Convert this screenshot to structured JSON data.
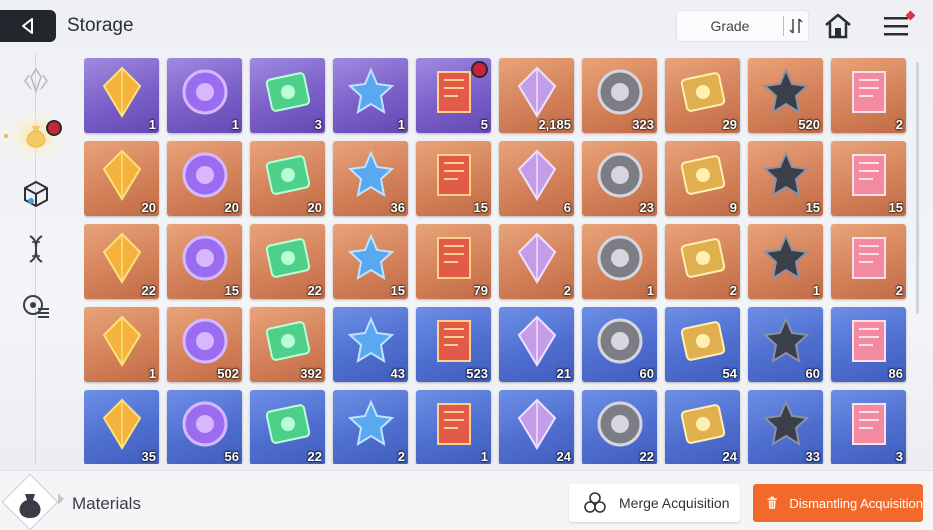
{
  "header": {
    "title": "Storage",
    "sort_label": "Grade"
  },
  "sidebar": {
    "items": [
      {
        "name": "crystal-tab",
        "active": false
      },
      {
        "name": "materials-tab",
        "active": true,
        "badge": true
      },
      {
        "name": "cube-tab",
        "active": false
      },
      {
        "name": "dna-tab",
        "active": false
      },
      {
        "name": "gear-list-tab",
        "active": false
      }
    ]
  },
  "items": [
    {
      "name": "tarot-cards",
      "count": "1",
      "rarity": "purple",
      "badge": false
    },
    {
      "name": "dark-orb",
      "count": "1",
      "rarity": "purple",
      "badge": false
    },
    {
      "name": "stone-idol-head",
      "count": "3",
      "rarity": "purple",
      "badge": false
    },
    {
      "name": "red-stone-head",
      "count": "1",
      "rarity": "purple",
      "badge": false
    },
    {
      "name": "pyramid-relic",
      "count": "5",
      "rarity": "purple",
      "badge": true
    },
    {
      "name": "blue-eye-creature",
      "count": "2,185",
      "rarity": "orange",
      "badge": false
    },
    {
      "name": "dark-chip",
      "count": "323",
      "rarity": "orange",
      "badge": false
    },
    {
      "name": "gold-id-card",
      "count": "29",
      "rarity": "orange",
      "badge": false
    },
    {
      "name": "gold-ticket",
      "count": "520",
      "rarity": "orange",
      "badge": false
    },
    {
      "name": "moon-feather",
      "count": "2",
      "rarity": "orange",
      "badge": false
    },
    {
      "name": "orange-crystal",
      "count": "20",
      "rarity": "orange",
      "badge": false
    },
    {
      "name": "purple-crystal",
      "count": "20",
      "rarity": "orange",
      "badge": false
    },
    {
      "name": "green-crystal",
      "count": "20",
      "rarity": "orange",
      "badge": false
    },
    {
      "name": "blue-crystal",
      "count": "36",
      "rarity": "orange",
      "badge": false
    },
    {
      "name": "eye-book",
      "count": "15",
      "rarity": "orange",
      "badge": false
    },
    {
      "name": "cross-book",
      "count": "6",
      "rarity": "orange",
      "badge": false
    },
    {
      "name": "bolt-book",
      "count": "23",
      "rarity": "orange",
      "badge": false
    },
    {
      "name": "atom-book",
      "count": "9",
      "rarity": "orange",
      "badge": false
    },
    {
      "name": "sword-medal",
      "count": "15",
      "rarity": "orange",
      "badge": false
    },
    {
      "name": "shield-medal",
      "count": "15",
      "rarity": "orange",
      "badge": false
    },
    {
      "name": "eye-medal",
      "count": "22",
      "rarity": "orange",
      "badge": false
    },
    {
      "name": "cross-medal",
      "count": "15",
      "rarity": "orange",
      "badge": false
    },
    {
      "name": "compass-medal",
      "count": "22",
      "rarity": "orange",
      "badge": false
    },
    {
      "name": "atom-medal",
      "count": "15",
      "rarity": "orange",
      "badge": false
    },
    {
      "name": "green-sprout",
      "count": "79",
      "rarity": "orange",
      "badge": false
    },
    {
      "name": "dark-gem-cube",
      "count": "2",
      "rarity": "orange",
      "badge": false
    },
    {
      "name": "sneakers",
      "count": "1",
      "rarity": "orange",
      "badge": false
    },
    {
      "name": "spray-bottle",
      "count": "2",
      "rarity": "orange",
      "badge": false
    },
    {
      "name": "dreamcatcher",
      "count": "1",
      "rarity": "orange",
      "badge": false
    },
    {
      "name": "old-book",
      "count": "2",
      "rarity": "orange",
      "badge": false
    },
    {
      "name": "pink-pick",
      "count": "1",
      "rarity": "orange",
      "badge": false
    },
    {
      "name": "music-scroll",
      "count": "502",
      "rarity": "orange",
      "badge": false
    },
    {
      "name": "black-flower",
      "count": "392",
      "rarity": "orange",
      "badge": false
    },
    {
      "name": "blue-id-card",
      "count": "43",
      "rarity": "blue",
      "badge": false
    },
    {
      "name": "blue-ticket",
      "count": "523",
      "rarity": "blue",
      "badge": false
    },
    {
      "name": "red-shard",
      "count": "21",
      "rarity": "blue",
      "badge": false
    },
    {
      "name": "orange-shard",
      "count": "60",
      "rarity": "blue",
      "badge": false
    },
    {
      "name": "purple-shard",
      "count": "54",
      "rarity": "blue",
      "badge": false
    },
    {
      "name": "green-shard",
      "count": "60",
      "rarity": "blue",
      "badge": false
    },
    {
      "name": "blue-shard",
      "count": "86",
      "rarity": "blue",
      "badge": false
    },
    {
      "name": "shield-book-blue",
      "count": "35",
      "rarity": "blue",
      "badge": false
    },
    {
      "name": "cross-book-blue",
      "count": "56",
      "rarity": "blue",
      "badge": false
    },
    {
      "name": "bolt-book-blue",
      "count": "22",
      "rarity": "blue",
      "badge": false
    },
    {
      "name": "atom-book-blue",
      "count": "2",
      "rarity": "blue",
      "badge": false
    },
    {
      "name": "shield-medal-silver",
      "count": "1",
      "rarity": "blue",
      "badge": false
    },
    {
      "name": "eye-medal-silver",
      "count": "24",
      "rarity": "blue",
      "badge": false
    },
    {
      "name": "cross-medal-silver",
      "count": "22",
      "rarity": "blue",
      "badge": false
    },
    {
      "name": "compass-medal-silver",
      "count": "24",
      "rarity": "blue",
      "badge": false
    },
    {
      "name": "ice-gem",
      "count": "33",
      "rarity": "blue",
      "badge": false
    },
    {
      "name": "strawberry-cake",
      "count": "3",
      "rarity": "blue",
      "badge": false
    }
  ],
  "footer": {
    "category_label": "Materials",
    "merge_label": "Merge Acquisition",
    "dismantle_label": "Dismantling Acquisition"
  },
  "colors": {
    "purple": "#7a5fc8",
    "orange": "#d4825a",
    "blue": "#4f6fd0",
    "accent": "#f16a2c"
  }
}
